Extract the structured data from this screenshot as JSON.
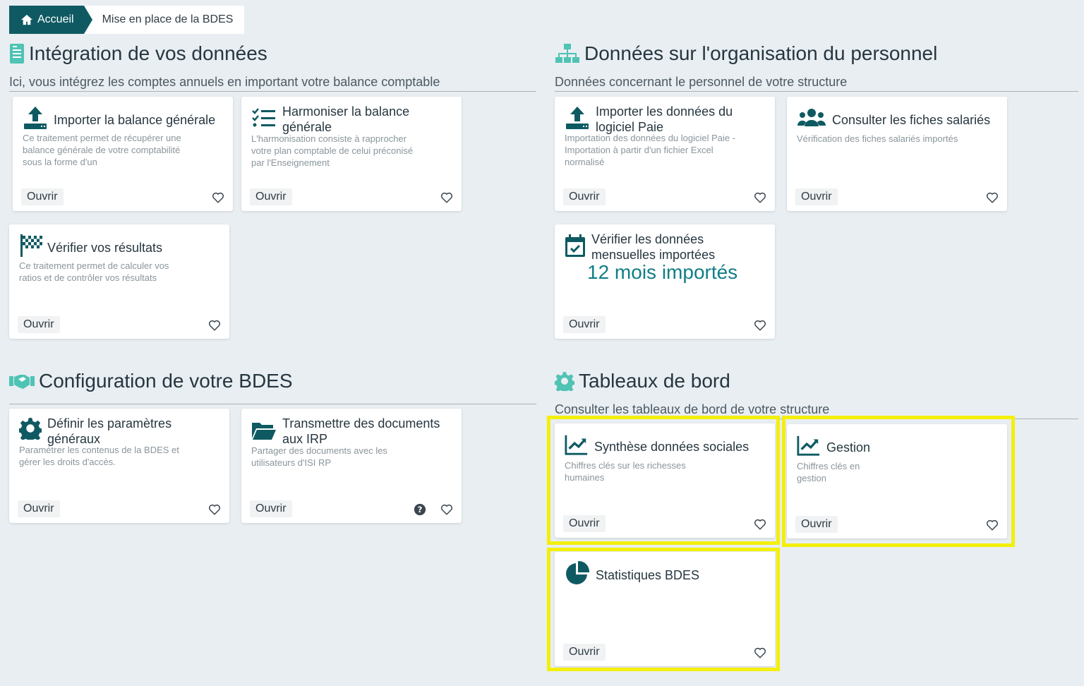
{
  "breadcrumb": {
    "home": "Accueil",
    "current": "Mise en place de la BDES"
  },
  "colors": {
    "brand": "#0f5a62",
    "accent_icon": "#4fc3b4",
    "stat": "#117e86",
    "highlight": "#f4ef0b",
    "background": "#e8eef2"
  },
  "sections": {
    "integration": {
      "title": "Intégration de vos données",
      "subtitle": "Ici, vous intégrez les comptes annuels en important votre balance comptable",
      "icon": "document-icon",
      "cards": [
        {
          "title": "Importer la balance générale",
          "desc": "Ce traitement permet de récupérer une balance générale de votre comptabilité sous la forme d'un",
          "open": "Ouvrir",
          "icon": "upload-icon"
        },
        {
          "title": "Harmoniser la balance générale",
          "desc": "L'harmonisation consiste à rapprocher votre plan comptable de celui préconisé par l'Enseignement",
          "open": "Ouvrir",
          "icon": "checklist-icon"
        },
        {
          "title": "Vérifier vos résultats",
          "desc": "Ce traitement permet de calculer vos ratios et de contrôler vos résultats",
          "open": "Ouvrir",
          "icon": "flag-checkered-icon"
        }
      ]
    },
    "organisation": {
      "title": "Données sur l'organisation du personnel",
      "subtitle": "Données concernant le personnel de votre structure",
      "icon": "org-chart-icon",
      "cards": [
        {
          "title": "Importer les données du logiciel Paie",
          "desc": "Importation des données du logiciel Paie - Importation à partir d'un fichier Excel normalisé",
          "open": "Ouvrir",
          "icon": "upload-icon"
        },
        {
          "title": "Consulter les fiches salariés",
          "desc": "Vérification des fiches salariés importés",
          "open": "Ouvrir",
          "icon": "users-icon"
        },
        {
          "title": "Vérifier les données mensuelles importées",
          "stat": "12 mois importés",
          "open": "Ouvrir",
          "icon": "calendar-check-icon"
        }
      ]
    },
    "configuration": {
      "title": "Configuration de votre BDES",
      "icon": "handshake-icon",
      "cards": [
        {
          "title": "Définir les paramètres généraux",
          "desc": "Paramétrer les contenus de la BDES et gérer les droits d'accès.",
          "open": "Ouvrir",
          "icon": "gear-icon"
        },
        {
          "title": "Transmettre des documents aux IRP",
          "desc": "Partager des documents avec les utilisateurs d'ISI RP",
          "open": "Ouvrir",
          "icon": "folder-open-icon"
        }
      ]
    },
    "tableaux": {
      "title": "Tableaux de bord",
      "subtitle": "Consulter les tableaux de bord de votre structure",
      "icon": "gear-icon",
      "cards": [
        {
          "title": "Synthèse données sociales",
          "desc": "Chiffres clés sur les richesses humaines",
          "open": "Ouvrir",
          "icon": "chart-line-icon"
        },
        {
          "title": "Gestion",
          "desc": "Chiffres clés en gestion",
          "open": "Ouvrir",
          "icon": "chart-line-icon"
        },
        {
          "title": "Statistiques BDES",
          "open": "Ouvrir",
          "icon": "pie-chart-icon"
        }
      ]
    }
  }
}
